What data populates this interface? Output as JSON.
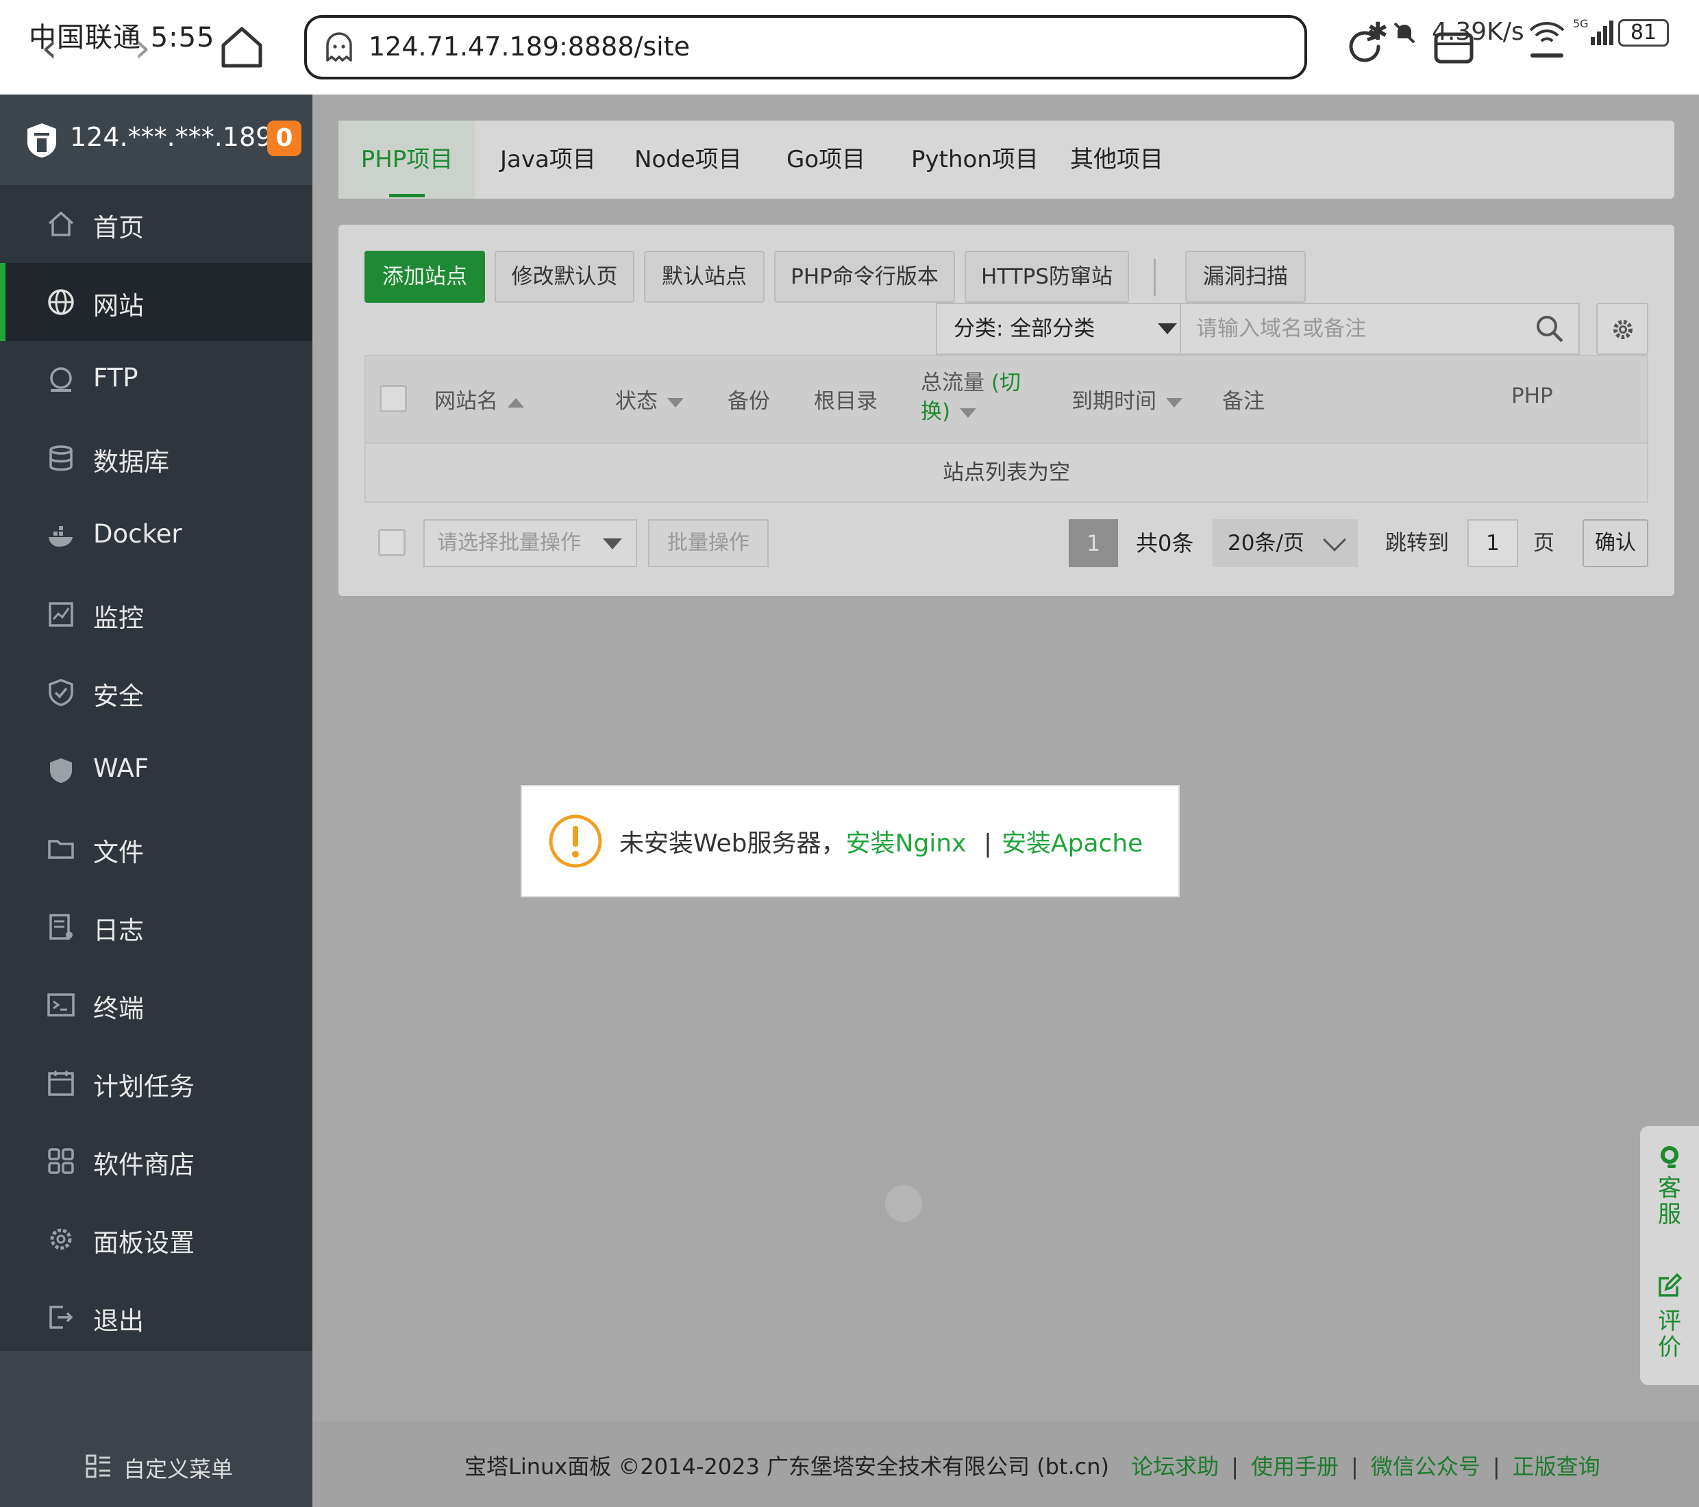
{
  "status_bar": {
    "carrier_time": "中国联通 5:55",
    "net_speed": "4.39K/s",
    "network": "5G",
    "battery": "81"
  },
  "browser": {
    "url": "124.71.47.189:8888/site"
  },
  "sidebar": {
    "host": "124.***.***.189",
    "badge": "0",
    "items": [
      {
        "label": "首页",
        "icon": "home-icon"
      },
      {
        "label": "网站",
        "icon": "globe-icon"
      },
      {
        "label": "FTP",
        "icon": "ftp-icon"
      },
      {
        "label": "数据库",
        "icon": "database-icon"
      },
      {
        "label": "Docker",
        "icon": "docker-icon"
      },
      {
        "label": "监控",
        "icon": "monitor-icon"
      },
      {
        "label": "安全",
        "icon": "shield-check-icon"
      },
      {
        "label": "WAF",
        "icon": "waf-shield-icon"
      },
      {
        "label": "文件",
        "icon": "folder-icon"
      },
      {
        "label": "日志",
        "icon": "log-icon"
      },
      {
        "label": "终端",
        "icon": "terminal-icon"
      },
      {
        "label": "计划任务",
        "icon": "calendar-icon"
      },
      {
        "label": "软件商店",
        "icon": "apps-icon"
      },
      {
        "label": "面板设置",
        "icon": "gear-icon"
      },
      {
        "label": "退出",
        "icon": "logout-icon"
      }
    ],
    "active_index": 1,
    "custom_menu": "自定义菜单"
  },
  "project_tabs": [
    "PHP项目",
    "Java项目",
    "Node项目",
    "Go项目",
    "Python项目",
    "其他项目"
  ],
  "toolbar": {
    "add_site": "添加站点",
    "edit_default_page": "修改默认页",
    "default_site": "默认站点",
    "php_cli_version": "PHP命令行版本",
    "https_anti_hijack": "HTTPS防窜站",
    "vuln_scan": "漏洞扫描",
    "category": "分类: 全部分类",
    "search_placeholder": "请输入域名或备注"
  },
  "table": {
    "columns": {
      "site_name": "网站名",
      "status": "状态",
      "backup": "备份",
      "root_dir": "根目录",
      "traffic": "总流量",
      "traffic_switch_a": "(切",
      "traffic_switch_b": "换)",
      "expire": "到期时间",
      "remark": "备注",
      "php": "PHP"
    },
    "empty_text": "站点列表为空"
  },
  "pagination": {
    "batch_placeholder": "请选择批量操作",
    "batch_button": "批量操作",
    "current_page": "1",
    "total": "共0条",
    "page_size": "20条/页",
    "jump_label": "跳转到",
    "jump_value": "1",
    "page_unit": "页",
    "confirm": "确认"
  },
  "modal": {
    "message": "未安装Web服务器，",
    "install_nginx": "安装Nginx",
    "separator": "|",
    "install_apache": "安装Apache"
  },
  "float": {
    "service": "客服",
    "review": "评价"
  },
  "footer": {
    "copyright": "宝塔Linux面板 ©2014-2023 广东堡塔安全技术有限公司 (bt.cn)",
    "links": [
      "论坛求助",
      "使用手册",
      "微信公众号",
      "正版查询"
    ]
  },
  "colors": {
    "accent": "#20a53a",
    "sidebar_bg": "#2f353c",
    "badge": "#f37f22",
    "warning": "#f0a020"
  }
}
